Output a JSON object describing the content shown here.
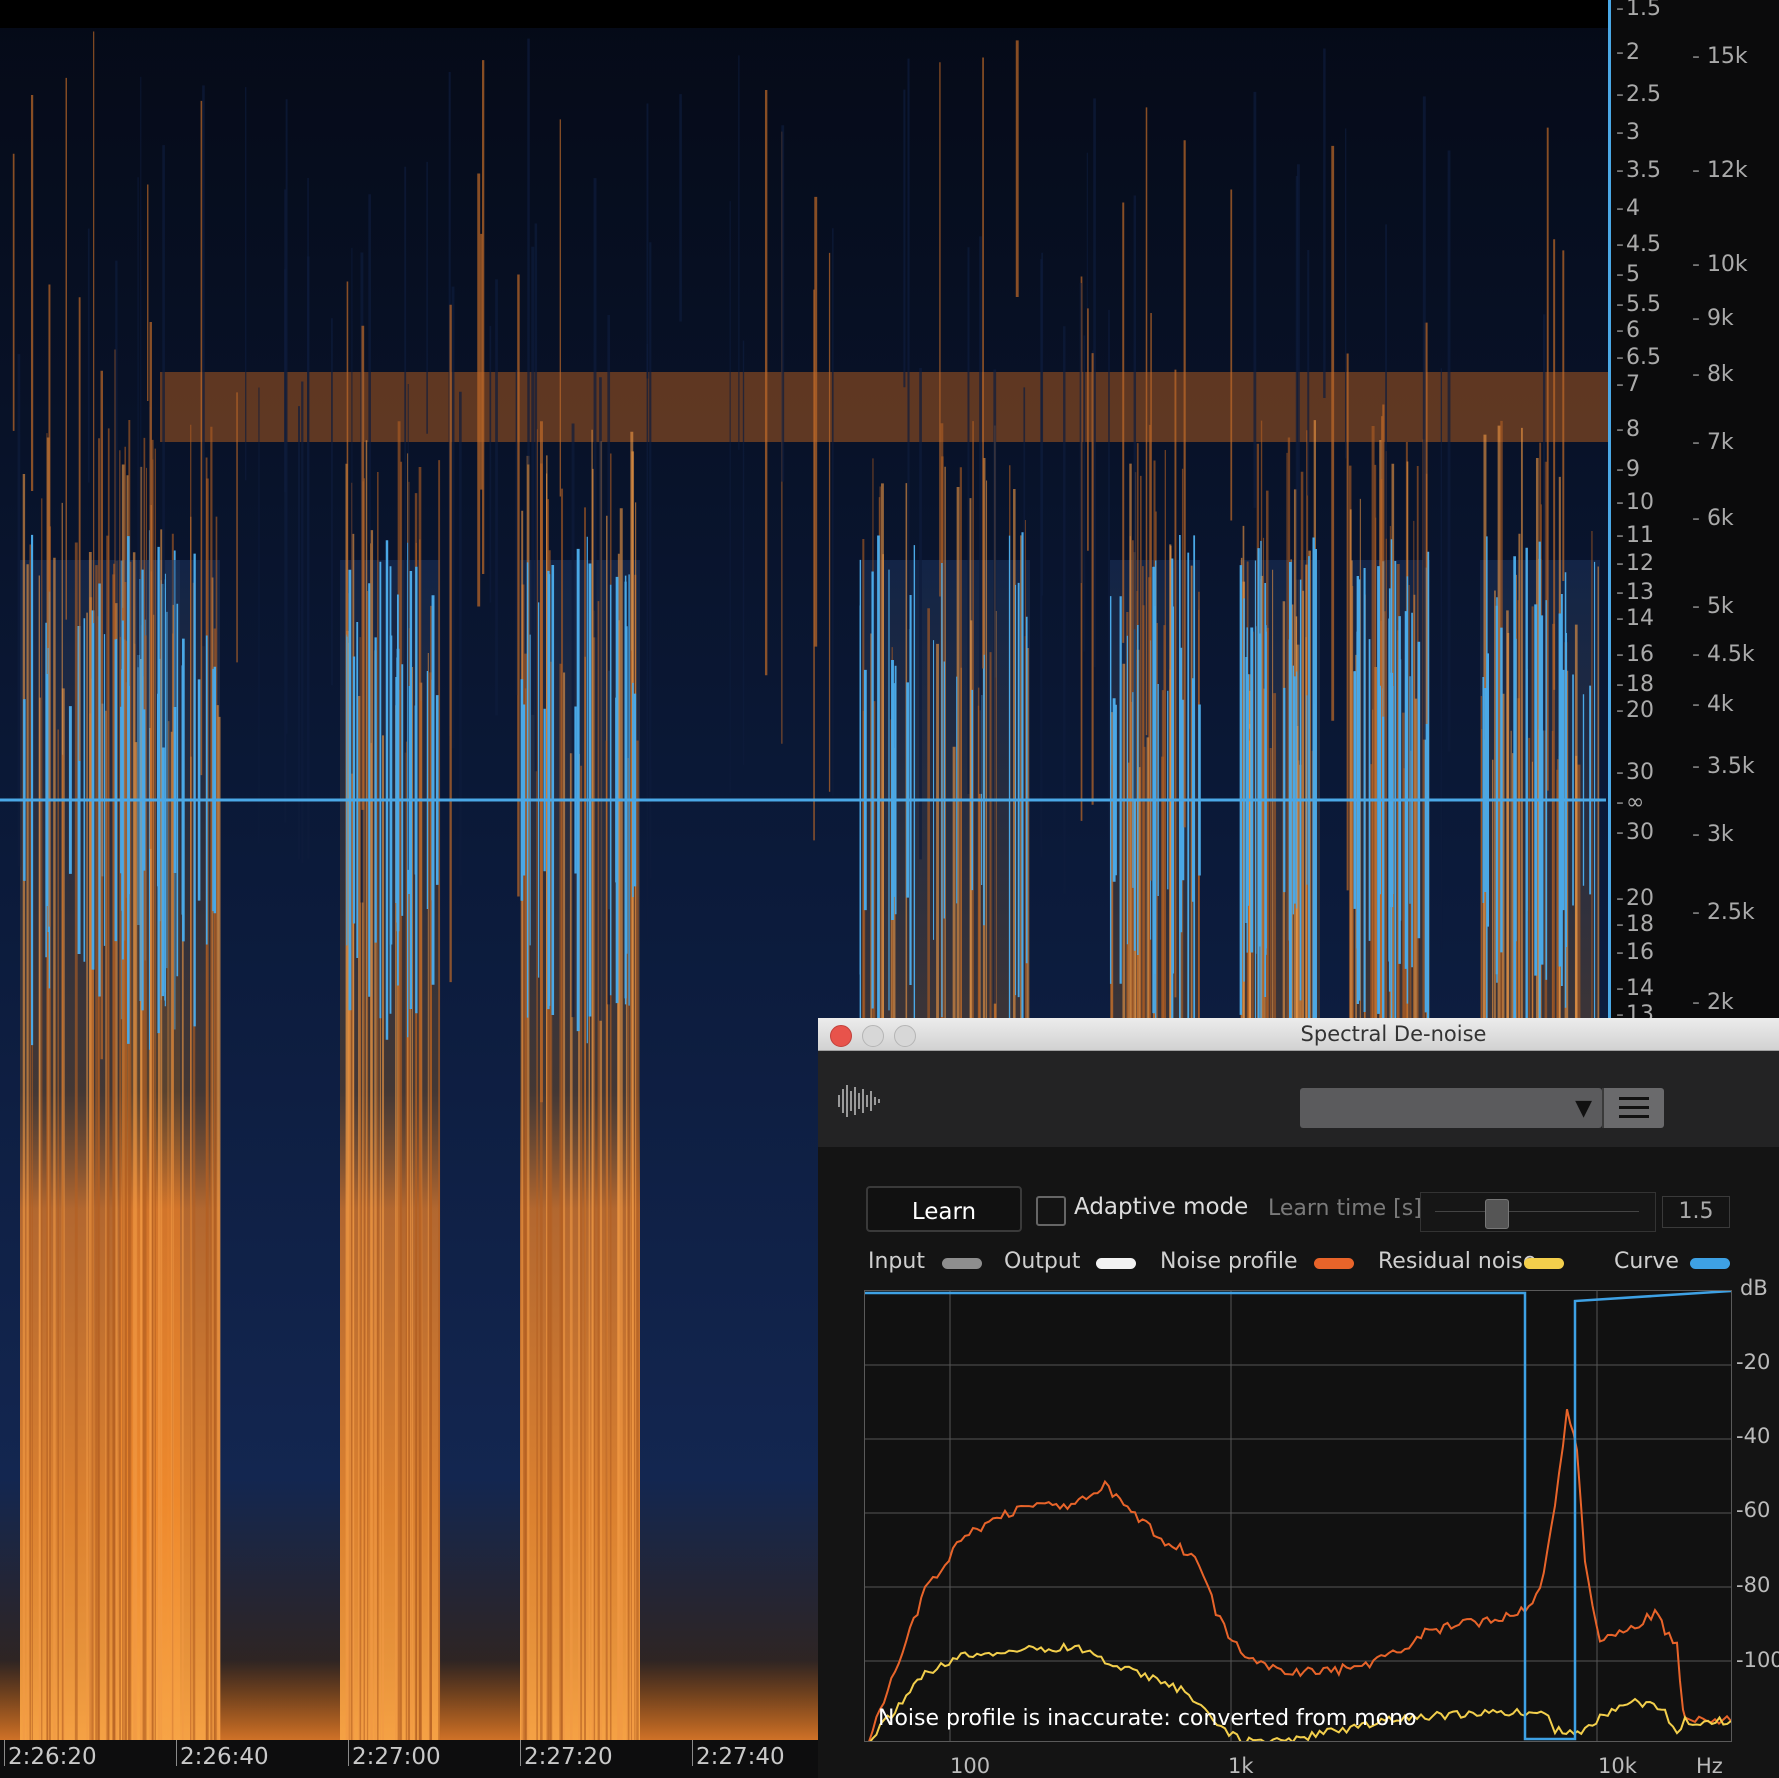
{
  "time_ruler": {
    "ticks": [
      "2:26:20",
      "2:26:40",
      "2:27:00",
      "2:27:20",
      "2:27:40"
    ]
  },
  "db_scale": {
    "labels": [
      "1.5",
      "2",
      "2.5",
      "3",
      "3.5",
      "4",
      "4.5",
      "5",
      "5.5",
      "6",
      "6.5",
      "7",
      "8",
      "9",
      "10",
      "11",
      "12",
      "13",
      "14",
      "16",
      "18",
      "20",
      "30",
      "∞",
      "30",
      "20",
      "18",
      "16",
      "14",
      "13"
    ]
  },
  "hz_scale": {
    "labels": [
      "15k",
      "12k",
      "10k",
      "9k",
      "8k",
      "7k",
      "6k",
      "5k",
      "4.5k",
      "4k",
      "3.5k",
      "3k",
      "2.5k",
      "2k"
    ]
  },
  "plugin": {
    "title": "Spectral De-noise",
    "learn_button": "Learn",
    "adaptive_mode_label": "Adaptive mode",
    "adaptive_mode_checked": false,
    "learn_time_label": "Learn time [s]",
    "learn_time_value": "1.5",
    "learn_time_slider_fraction": 0.2,
    "legend": [
      {
        "label": "Input",
        "color": "#8e8e8e"
      },
      {
        "label": "Output",
        "color": "#f2f2f2"
      },
      {
        "label": "Noise profile",
        "color": "#e8642a"
      },
      {
        "label": "Residual noise",
        "color": "#f3cf4c"
      },
      {
        "label": "Curve",
        "color": "#3ea1e4"
      }
    ],
    "graph": {
      "y_unit": "dB",
      "y_labels": [
        "20",
        "40",
        "60",
        "80",
        "100"
      ],
      "x_unit": "Hz",
      "x_labels": [
        "100",
        "1k",
        "10k"
      ],
      "warning": "Noise profile is inaccurate: converted from mono"
    }
  }
}
